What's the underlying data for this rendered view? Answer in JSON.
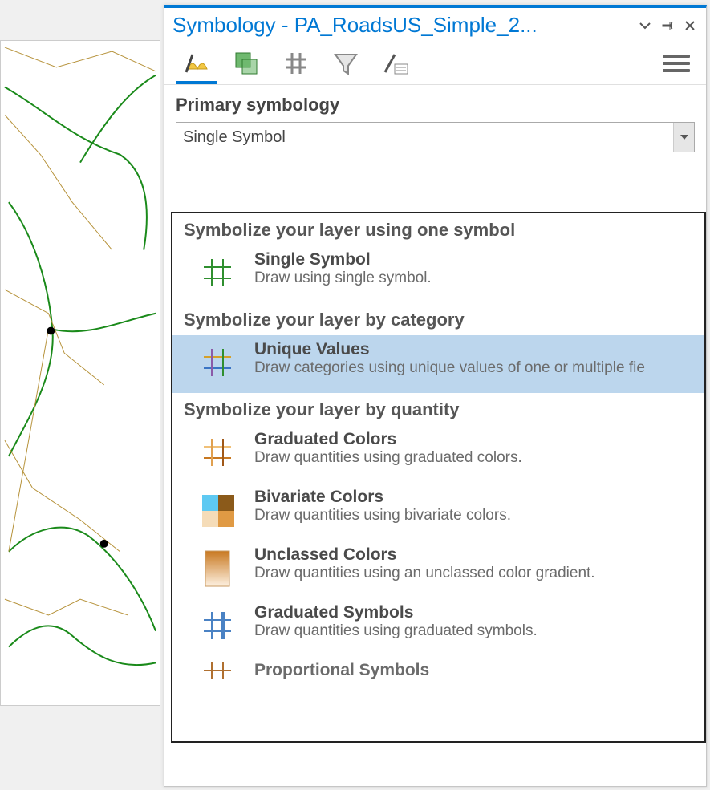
{
  "pane": {
    "title": "Symbology - PA_RoadsUS_Simple_2...",
    "section_label": "Primary symbology",
    "combo_value": "Single Symbol"
  },
  "dropdown": {
    "groups": [
      {
        "header": "Symbolize your layer using one symbol",
        "options": [
          {
            "key": "single",
            "title": "Single Symbol",
            "desc": "Draw using single symbol.",
            "highlight": false
          }
        ]
      },
      {
        "header": "Symbolize your layer by category",
        "options": [
          {
            "key": "unique",
            "title": "Unique Values",
            "desc": "Draw categories using unique values of one or multiple fie",
            "highlight": true
          }
        ]
      },
      {
        "header": "Symbolize your layer by quantity",
        "options": [
          {
            "key": "gradcolors",
            "title": "Graduated Colors",
            "desc": "Draw quantities using graduated colors.",
            "highlight": false
          },
          {
            "key": "bivariate",
            "title": "Bivariate Colors",
            "desc": "Draw quantities using bivariate colors.",
            "highlight": false
          },
          {
            "key": "unclassed",
            "title": "Unclassed Colors",
            "desc": "Draw quantities using an unclassed color gradient.",
            "highlight": false
          },
          {
            "key": "gradsym",
            "title": "Graduated Symbols",
            "desc": "Draw quantities using graduated symbols.",
            "highlight": false
          },
          {
            "key": "prop",
            "title": "Proportional Symbols",
            "desc": "",
            "highlight": false,
            "truncated": true
          }
        ]
      }
    ]
  }
}
